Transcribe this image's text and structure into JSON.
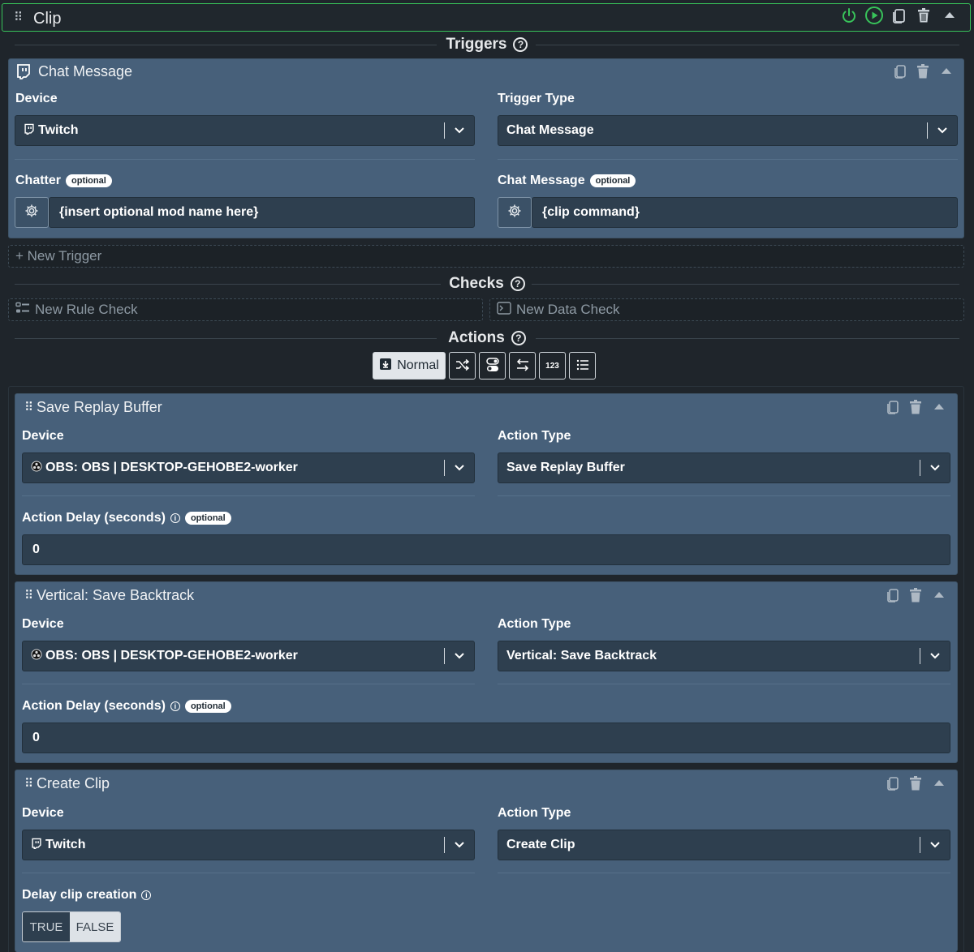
{
  "header": {
    "title": "Clip"
  },
  "sections": {
    "triggers": "Triggers",
    "checks": "Checks",
    "actions": "Actions"
  },
  "trigger": {
    "title": "Chat Message",
    "device_label": "Device",
    "device_value": "Twitch",
    "trigger_type_label": "Trigger Type",
    "trigger_type_value": "Chat Message",
    "chatter_label": "Chatter",
    "chatter_value": "{insert optional mod name here}",
    "chat_message_label": "Chat Message",
    "chat_message_value": "{clip command}",
    "optional": "optional"
  },
  "new_trigger": "+ New Trigger",
  "checks": {
    "rule": "New Rule Check",
    "data": "New Data Check"
  },
  "modes": {
    "normal": "Normal",
    "numbers": "123"
  },
  "actions": [
    {
      "title": "Save Replay Buffer",
      "device_label": "Device",
      "device_value": "OBS: OBS | DESKTOP-GEHOBE2-worker",
      "type_label": "Action Type",
      "type_value": "Save Replay Buffer",
      "delay_label": "Action Delay (seconds)",
      "delay_value": "0"
    },
    {
      "title": "Vertical: Save Backtrack",
      "device_label": "Device",
      "device_value": "OBS: OBS | DESKTOP-GEHOBE2-worker",
      "type_label": "Action Type",
      "type_value": "Vertical: Save Backtrack",
      "delay_label": "Action Delay (seconds)",
      "delay_value": "0"
    },
    {
      "title": "Create Clip",
      "device_label": "Device",
      "device_value": "Twitch",
      "type_label": "Action Type",
      "type_value": "Create Clip",
      "delay_clip_label": "Delay clip creation",
      "toggle_true": "TRUE",
      "toggle_false": "FALSE",
      "toggle_selected": "FALSE"
    }
  ],
  "optional": "optional",
  "colors": {
    "accent_green": "#38c35a",
    "card_bg": "#47607a",
    "field_bg": "#2e3f4f",
    "page_bg": "#1f252b"
  }
}
